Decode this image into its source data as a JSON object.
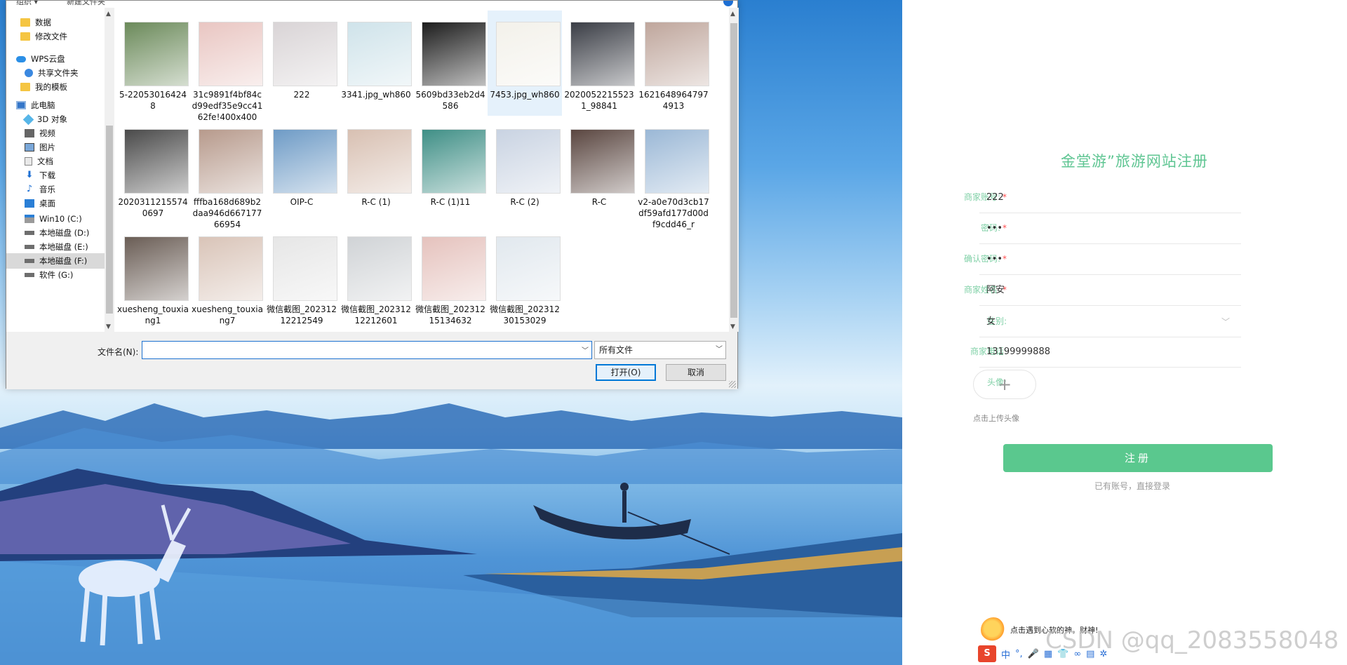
{
  "dialog": {
    "toolbar": {
      "organize": "组织 ▾",
      "new_folder": "新建文件夹"
    },
    "nav_items": [
      {
        "label": "数据",
        "icon": "folder-icon"
      },
      {
        "label": "修改文件",
        "icon": "folder-icon"
      },
      {
        "label": "WPS云盘",
        "icon": "cloud-icon"
      },
      {
        "label": "共享文件夹",
        "icon": "share-icon"
      },
      {
        "label": "我的模板",
        "icon": "folder-icon"
      },
      {
        "label": "此电脑",
        "icon": "computer-icon"
      },
      {
        "label": "3D 对象",
        "icon": "cube-icon"
      },
      {
        "label": "视频",
        "icon": "video-icon"
      },
      {
        "label": "图片",
        "icon": "picture-icon"
      },
      {
        "label": "文档",
        "icon": "document-icon"
      },
      {
        "label": "下载",
        "icon": "download-icon"
      },
      {
        "label": "音乐",
        "icon": "music-icon"
      },
      {
        "label": "桌面",
        "icon": "desktop-icon"
      },
      {
        "label": "Win10 (C:)",
        "icon": "drive-icon"
      },
      {
        "label": "本地磁盘 (D:)",
        "icon": "drive-icon"
      },
      {
        "label": "本地磁盘 (E:)",
        "icon": "drive-icon"
      },
      {
        "label": "本地磁盘 (F:)",
        "icon": "drive-icon"
      },
      {
        "label": "软件 (G:)",
        "icon": "drive-icon"
      }
    ],
    "files": [
      {
        "name": "5-220530164248",
        "color": "#6b8a5a"
      },
      {
        "name": "31c9891f4bf84cd99edf35e9cc4162fe!400x400",
        "color": "#e9c6c2"
      },
      {
        "name": "222",
        "color": "#d9d4d6"
      },
      {
        "name": "3341.jpg_wh860",
        "color": "#cfe3ea"
      },
      {
        "name": "5609bd33eb2d4586",
        "color": "#1c1c1c"
      },
      {
        "name": "7453.jpg_wh860",
        "color": "#f3f1ea"
      },
      {
        "name": "20200522155231_98841",
        "color": "#3a3d45"
      },
      {
        "name": "16216489647974913",
        "color": "#bfa69c"
      },
      {
        "name": "20203112155740697",
        "color": "#4a4a4a"
      },
      {
        "name": "fffba168d689b2daa946d66717766954",
        "color": "#b79a8c"
      },
      {
        "name": "OIP-C",
        "color": "#6e9bc6"
      },
      {
        "name": "R-C (1)",
        "color": "#d8c0b2"
      },
      {
        "name": "R-C (1)11",
        "color": "#3f8f86"
      },
      {
        "name": "R-C (2)",
        "color": "#c9d3e2"
      },
      {
        "name": "R-C",
        "color": "#5a4640"
      },
      {
        "name": "v2-a0e70d3cb17df59afd177d00df9cdd46_r",
        "color": "#9bb8d6"
      },
      {
        "name": "xuesheng_touxiang1",
        "color": "#6a5d55"
      },
      {
        "name": "xuesheng_touxiang7",
        "color": "#d9c4b8"
      },
      {
        "name": "微信截图_20231212212549",
        "color": "#e6e6e6"
      },
      {
        "name": "微信截图_20231212212601",
        "color": "#d0d3d6"
      },
      {
        "name": "微信截图_20231215134632",
        "color": "#e5c2bd"
      },
      {
        "name": "微信截图_20231230153029",
        "color": "#e1e8ee"
      }
    ],
    "filename_label": "文件名(N):",
    "filename_value": "",
    "filetype_value": "所有文件",
    "open_label": "打开(O)",
    "cancel_label": "取消"
  },
  "register": {
    "title": "金堂游”旅游网站注册",
    "fields": [
      {
        "label": "商家账号:",
        "required": true,
        "value": "222"
      },
      {
        "label": "密码:",
        "required": true,
        "value": "•••"
      },
      {
        "label": "确认密码:",
        "required": true,
        "value": "•••"
      },
      {
        "label": "商家姓名:",
        "required": true,
        "value": "阿安"
      },
      {
        "label": "性别:",
        "required": false,
        "value": "女"
      },
      {
        "label": "商家电话:",
        "required": false,
        "value": "13199999888"
      }
    ],
    "avatar_label": "头像:",
    "upload_plus": "+",
    "upload_hint": "点击上传头像",
    "submit_label": "注册",
    "login_link": "已有账号，直接登录"
  },
  "ime": {
    "tip": "点击遇到心软的神，财神!",
    "logo": "S",
    "items": [
      "中",
      "°,",
      "🎤",
      "▦",
      "👕",
      "∞",
      "▤",
      "✲"
    ]
  },
  "watermark": "CSDN @qq_2083558048"
}
